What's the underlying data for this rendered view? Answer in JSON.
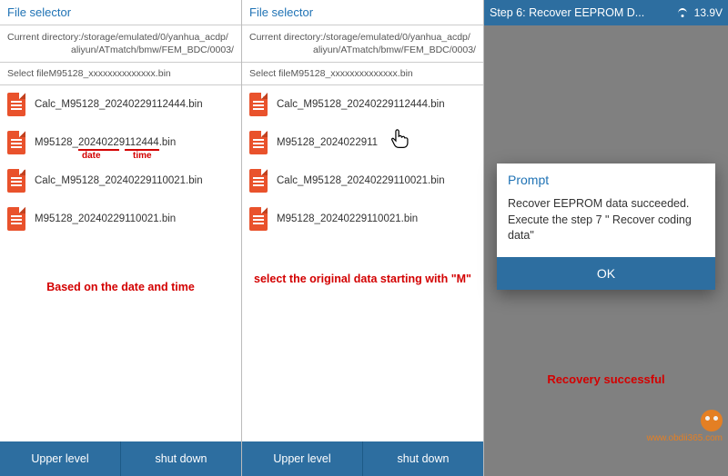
{
  "panel1": {
    "title": "File selector",
    "dir_label": "Current directory:",
    "dir_path1": "/storage/emulated/0/yanhua_acdp/",
    "dir_path2": "aliyun/ATmatch/bmw/FEM_BDC/0003/",
    "select_label": "Select fileM95128_xxxxxxxxxxxxxx.bin",
    "files": [
      "Calc_M95128_20240229112444.bin",
      "M95128_20240229112444.bin",
      "Calc_M95128_20240229110021.bin",
      "M95128_20240229110021.bin"
    ],
    "anno_date": "date",
    "anno_time": "time",
    "anno_main": "Based on the date and time",
    "upper": "Upper level",
    "shutdown": "shut down"
  },
  "panel2": {
    "title": "File selector",
    "dir_label": "Current directory:",
    "dir_path1": "/storage/emulated/0/yanhua_acdp/",
    "dir_path2": "aliyun/ATmatch/bmw/FEM_BDC/0003/",
    "select_label": "Select fileM95128_xxxxxxxxxxxxxx.bin",
    "files": [
      "Calc_M95128_20240229112444.bin",
      "M95128_2024022911",
      "Calc_M95128_20240229110021.bin",
      "M95128_20240229110021.bin"
    ],
    "anno_main": "select the original data starting with \"M\"",
    "upper": "Upper level",
    "shutdown": "shut down"
  },
  "panel3": {
    "step_title": "Step 6: Recover EEPROM D...",
    "voltage": "13.9V",
    "dialog_title": "Prompt",
    "dialog_body": "Recover EEPROM data succeeded. Execute the step 7 \" Recover coding data\"",
    "ok": "OK",
    "anno_main": "Recovery successful"
  },
  "watermark": "www.obdii365.com"
}
